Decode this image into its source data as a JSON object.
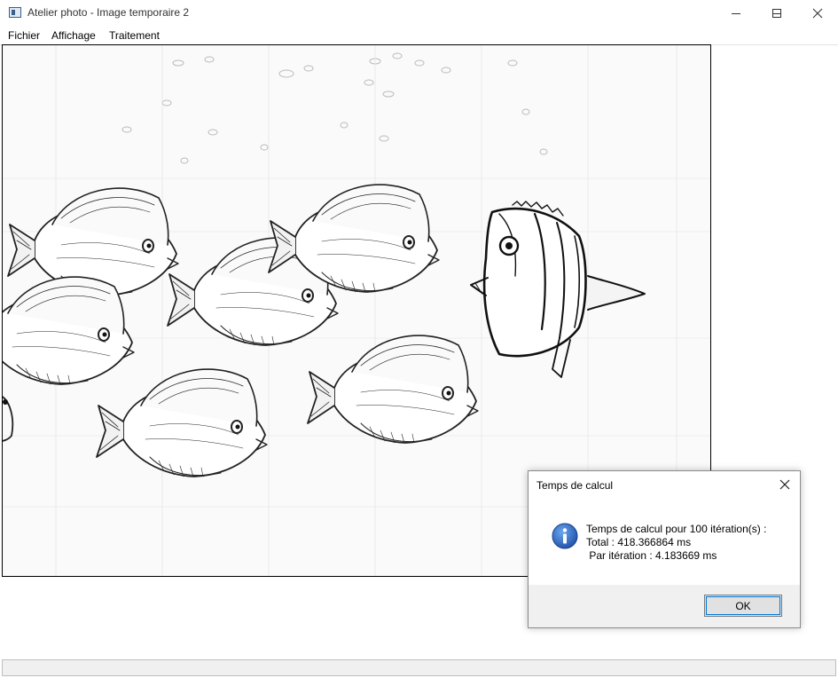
{
  "window": {
    "title": "Atelier photo - Image temporaire 2",
    "icon": "app-window-icon",
    "controls": [
      "minimize-icon",
      "maximize-icon",
      "close-icon"
    ]
  },
  "menu": {
    "items": [
      "Fichier",
      "Affichage",
      "Traitement"
    ]
  },
  "image": {
    "description_icon": "fish-sketch-image",
    "style": "pencil-sketch-edge-filter"
  },
  "dialog": {
    "title": "Temps de calcul",
    "icon": "info-icon",
    "message_line1": "Temps de calcul pour 100 itération(s) :",
    "message_line2": "Total : 418.366864 ms",
    "message_line3": " Par itération : 4.183669 ms",
    "ok_label": "OK"
  },
  "colors": {
    "accent": "#0078d7",
    "info_icon_blue": "#1f5fbf"
  }
}
